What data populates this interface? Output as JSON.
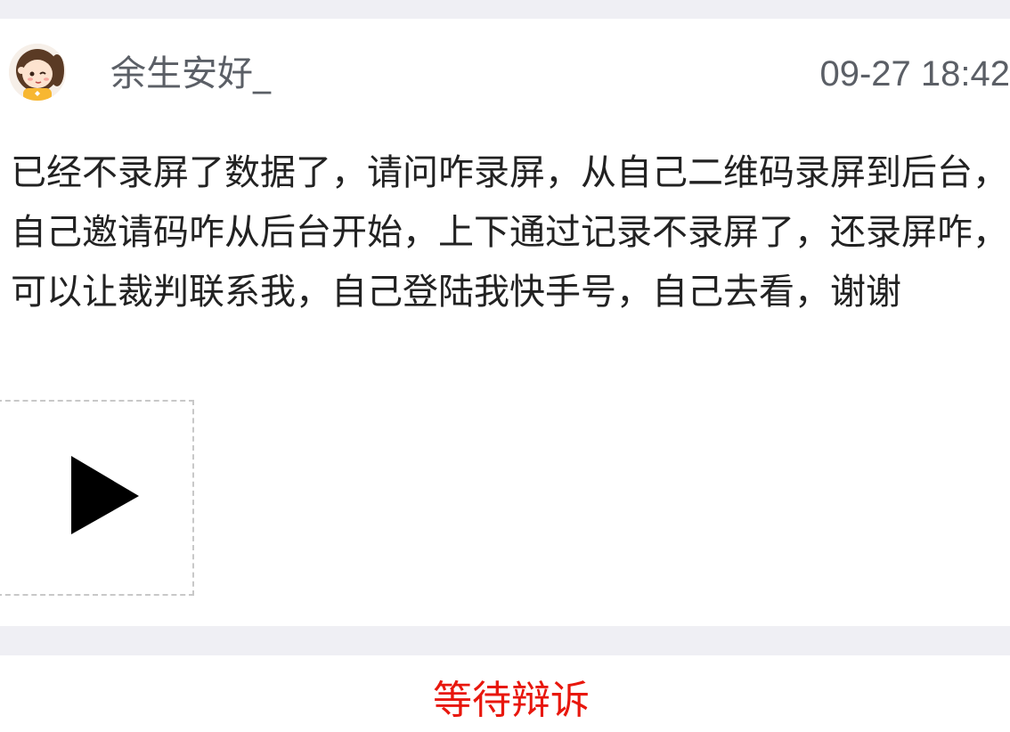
{
  "post": {
    "username": "余生安好_",
    "timestamp": "09-27 18:42",
    "content": "已经不录屏了数据了，请问咋录屏，从自己二维码录屏到后台，自己邀请码咋从后台开始，上下通过记录不录屏了，还录屏咋，可以让裁判联系我，自己登陆我快手号，自己去看，谢谢"
  },
  "status": {
    "label": "等待辩诉",
    "color": "#e8170d"
  },
  "icons": {
    "avatar": "avatar-girl-icon",
    "video": "play-icon"
  }
}
